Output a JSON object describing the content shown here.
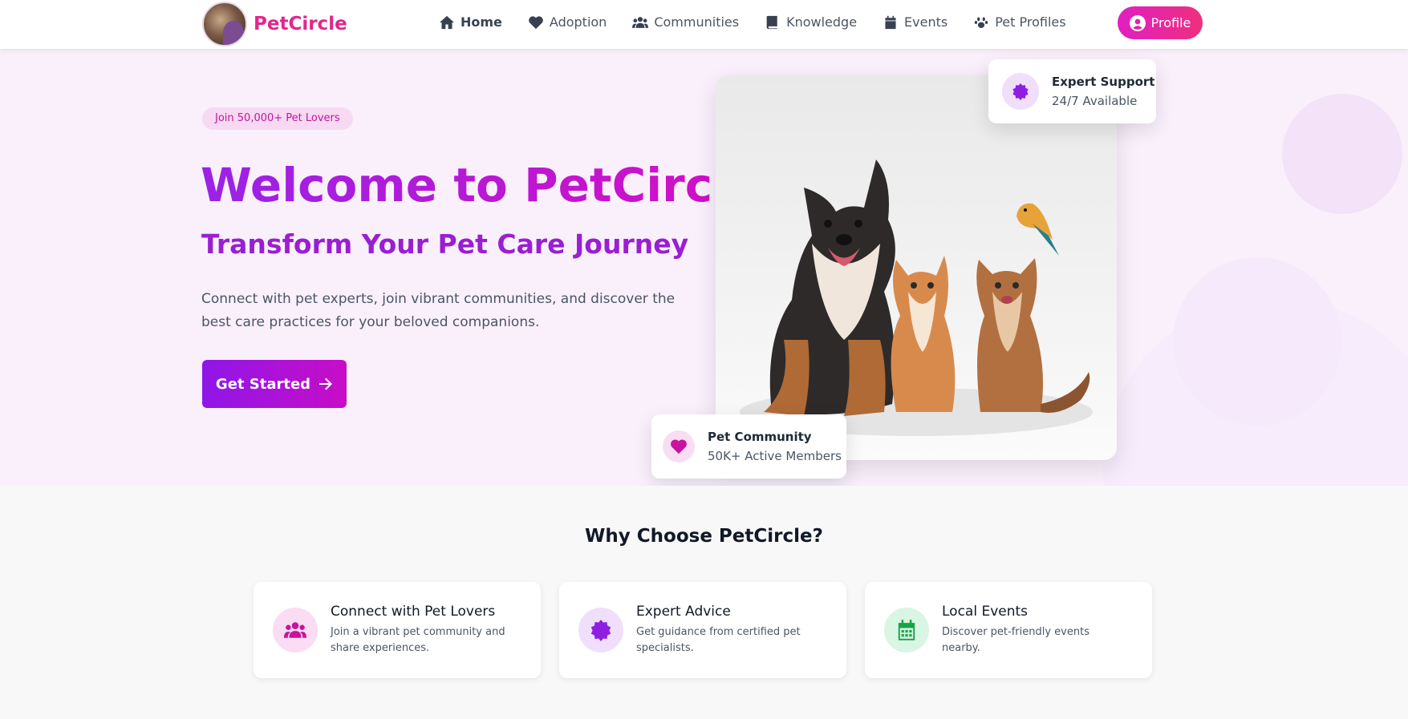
{
  "brand": {
    "name": "PetCircle"
  },
  "nav": {
    "items": [
      {
        "label": "Home",
        "icon": "home-icon"
      },
      {
        "label": "Adoption",
        "icon": "heart-icon"
      },
      {
        "label": "Communities",
        "icon": "users-icon"
      },
      {
        "label": "Knowledge",
        "icon": "book-icon"
      },
      {
        "label": "Events",
        "icon": "calendar-icon"
      },
      {
        "label": "Pet Profiles",
        "icon": "paw-icon"
      }
    ],
    "profile_label": "Profile"
  },
  "hero": {
    "badge": "Join 50,000+ Pet Lovers",
    "title": "Welcome to PetCircle",
    "subtitle": "Transform Your Pet Care Journey",
    "description": "Connect with pet experts, join vibrant communities, and discover the best care practices for your beloved companions.",
    "cta_label": "Get Started"
  },
  "cards": {
    "support": {
      "title": "Expert Support",
      "subtitle": "24/7 Available"
    },
    "community": {
      "title": "Pet Community",
      "subtitle": "50K+ Active Members"
    }
  },
  "why": {
    "title": "Why Choose PetCircle?",
    "features": [
      {
        "title": "Connect with Pet Lovers",
        "description": "Join a vibrant pet community and share experiences.",
        "icon": "users-icon"
      },
      {
        "title": "Expert Advice",
        "description": "Get guidance from certified pet specialists.",
        "icon": "badge-icon"
      },
      {
        "title": "Local Events",
        "description": "Discover pet-friendly events nearby.",
        "icon": "calendar-icon"
      }
    ]
  },
  "colors": {
    "brand_pink": "#e0278e",
    "accent_purple": "#9a22e6",
    "accent_magenta": "#d70ec4",
    "success_green": "#16a34a"
  }
}
